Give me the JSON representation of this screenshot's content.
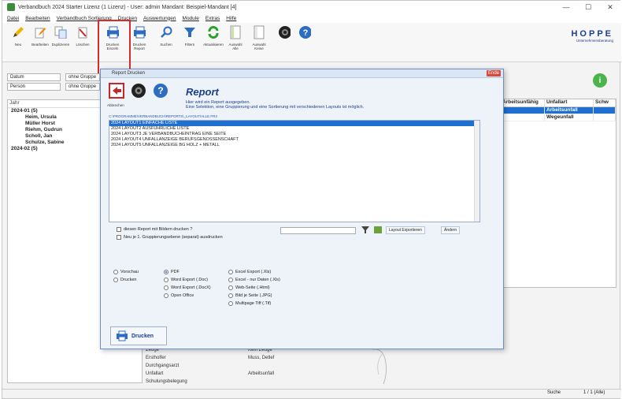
{
  "window": {
    "title": "Verbandbuch 2024 Starter Lizenz (1 Lizenz) - User: admin Mandant: Beispiel-Mandant [4]",
    "controls": [
      "—",
      "☐",
      "✕"
    ]
  },
  "menu": [
    "Datei",
    "Bearbeiten",
    "Verbandbuch Sortierung",
    "Drucken",
    "Auswertungen",
    "Module",
    "Extras",
    "Hilfe"
  ],
  "ribbon": {
    "buttons": [
      {
        "icon": "pencil-icon",
        "label": "Neu"
      },
      {
        "icon": "edit-icon",
        "label": "Bearbeiten"
      },
      {
        "icon": "copy-icon",
        "label": "Duplizieren"
      },
      {
        "icon": "delete-icon",
        "label": "Löschen"
      },
      {
        "icon": "printer-icon",
        "label": "Drucken Einzeln"
      },
      {
        "icon": "printer-report-icon",
        "label": "Drucken Report"
      },
      {
        "icon": "search-icon",
        "label": "Suchen"
      },
      {
        "icon": "filter-icon",
        "label": "Filtern"
      },
      {
        "icon": "refresh-icon",
        "label": "Aktualisieren"
      },
      {
        "icon": "selection-icon",
        "label": "Auswahl Alle"
      },
      {
        "icon": "selection-none-icon",
        "label": "Auswahl Keine"
      },
      {
        "icon": "camera-icon",
        "label": ""
      },
      {
        "icon": "help-icon",
        "label": ""
      }
    ],
    "logo": {
      "name": "HOPPE",
      "sub": "Unternehmensberatung"
    }
  },
  "filters": [
    {
      "field": "Datum",
      "value": "ohne Gruppe"
    },
    {
      "field": "Person",
      "value": "ohne Gruppe"
    }
  ],
  "tree": {
    "header": "Jahr",
    "nodes": [
      {
        "type": "folder",
        "label": "2024-01 (5)"
      },
      {
        "type": "person",
        "label": "Heim, Ursula"
      },
      {
        "type": "person",
        "label": "Müller Horst"
      },
      {
        "type": "person",
        "label": "Riehm, Gudrun"
      },
      {
        "type": "person",
        "label": "Scholl, Jan"
      },
      {
        "type": "person",
        "label": "Schulze, Sabine"
      },
      {
        "type": "folder",
        "label": "2024-02 (5)"
      }
    ]
  },
  "grid": {
    "columns": [
      "Arbeitsunfähig",
      "Unfallart",
      "Schw"
    ],
    "rows": [
      [
        "",
        "Arbeitsunfall",
        ""
      ],
      [
        "",
        "Wegeunfall",
        ""
      ]
    ]
  },
  "details": [
    [
      "Zeuge",
      "Kein Zeuge"
    ],
    [
      "Erstholfer",
      "Muss, Detlef"
    ],
    [
      "Durchgangsarzt",
      ""
    ],
    [
      "Unfallart",
      "Arbeitsunfall"
    ],
    [
      "Schulungsbelegung",
      ""
    ]
  ],
  "dialog": {
    "title": "Report Drucken",
    "close": "Ende",
    "heading": "Report",
    "hint_line1": "Hier wird ein Report ausgegeben.",
    "hint_line2": "Eine Selektion, eine Gruppierung und eine Sortierung mit verschiedenen Layouts ist möglich.",
    "header_buttons": [
      {
        "icon": "exit-icon",
        "label": "Abbrechen"
      },
      {
        "icon": "camera-icon",
        "label": ""
      },
      {
        "icon": "help-icon",
        "label": ""
      }
    ],
    "path": "C:\\PROGRAMME\\VERBANDBUCH\\REPORTS\\_LAYOUT\\ALLE.FR3",
    "reports": [
      "2024 LAYOUT1 EINFACHE LISTE",
      "2024 LAYOUT2 AUSFÜHRLICHE LISTE",
      "2024 LAYOUT3 JE VERBANDBUCHEINTRAG EINE SEITE",
      "2024 LAYOUT4 UNFALLANZEIGE BERUFSGENOSSENSCHAFT",
      "2024 LAYOUT5 UNFALLANZEIGE BG HOLZ + METALL"
    ],
    "check1": "diesen Report mit Bildern drucken ?",
    "check2": "Neu je 1. Gruppierungsebene (separat) ausdrucken",
    "layout_export": "Layout Exportieren",
    "layout_edit": "Ändern",
    "output": [
      "Vorschau",
      "Drucken"
    ],
    "formats_col1": [
      "PDF",
      "Word Export (.Doc)",
      "Word Export (.DocX)",
      "Open Office"
    ],
    "formats_col2": [
      "Excel Export (.Xls)",
      "Excel - nur Daten (.Xls)",
      "Web-Seite (.Html)",
      "Bild je Seite (.JPG)",
      "Multipage Tiff (.Tif)"
    ],
    "print_button": "Drucken"
  },
  "statusbar": [
    "Suche",
    "1 / 1 (Alle)"
  ]
}
